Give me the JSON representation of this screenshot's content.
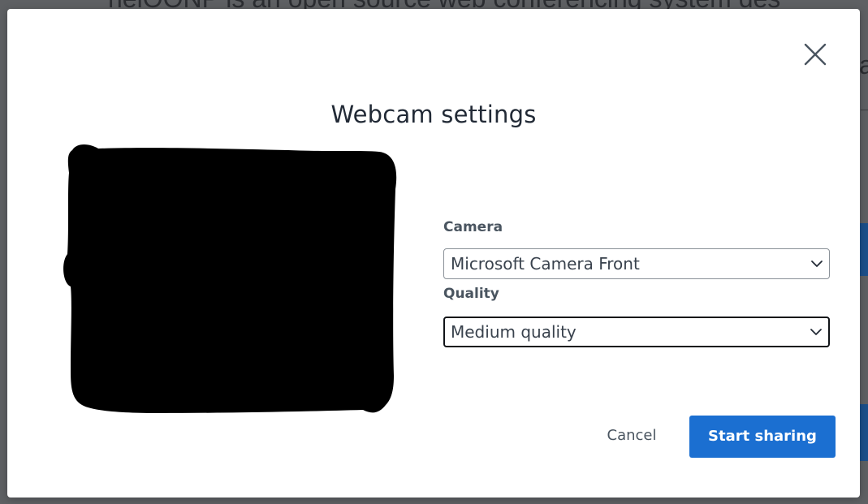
{
  "background": {
    "text_line_1": "helOONP is an open source web conferencing system des",
    "text_line_2": "a"
  },
  "dialog": {
    "title": "Webcam settings",
    "close_icon": "close-icon",
    "camera": {
      "label": "Camera",
      "selected": "Microsoft Camera Front",
      "icon": "chevron-down-icon"
    },
    "quality": {
      "label": "Quality",
      "selected": "Medium quality",
      "icon": "chevron-down-icon"
    },
    "actions": {
      "cancel_label": "Cancel",
      "start_label": "Start sharing"
    }
  },
  "colors": {
    "accent": "#1b6fd1",
    "title_text": "#222a36",
    "label_text": "#4a5560",
    "overlay": "#5e6063"
  }
}
